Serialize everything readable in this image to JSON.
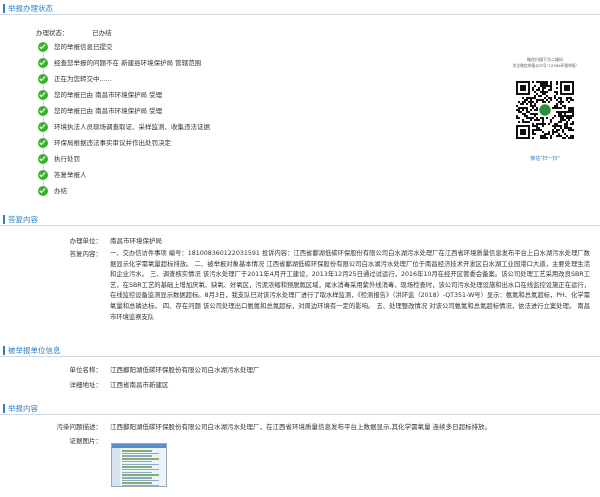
{
  "sections": {
    "progress": "举报办理状态",
    "reply": "答复内容",
    "reported_unit": "被举报单位信息",
    "report_content": "举报内容"
  },
  "status": {
    "label": "办理状态：",
    "value": "已办结"
  },
  "steps": [
    "您的举报信息已提交",
    "经查您举报的问题不在 新建县环境保护局 管辖范围",
    "正在为您转交中......",
    "您的举报已由 南昌市环境保护局 受理",
    "您的举报已由 南昌市环境保护局 受理",
    "环境执法人员现场调查取证、采样监测、收集违法证据",
    "环保局根据违法事实审议并作出处罚决定",
    "执行处罚",
    "答复举报人",
    "办结"
  ],
  "qr": {
    "caption_line1": "微信扫描下方二维码",
    "caption_line2": "关注微信举报公众号\"12369环保举报\"",
    "footer": "微信\"扫一扫\""
  },
  "reply": {
    "unit_label": "办理单位：",
    "unit_value": "南昌市环境保护局",
    "content_label": "答复内容：",
    "content_text": "一、交办信访件事项 编号：181008360122031591 投诉内容：江西省鄱湖低碳环保股份有限公司白水湖污水处理厂在江西省环境质量信息发布平台上白水湖污水处理厂数据显示化学需氧量超标排放。 二、被举报对象基本情况 江西省鄱湖低碳环保股份有限公司白水湖污水处理厂位于南昌经济技术开发区白水湖工业园港口大道，主要处理生活和企业污水。 三、调查核实情况 该污水处理厂于2011年4月开工建设，2013年12月25日通过试运行，2016年10月在经开区管委会备案。该公司处理工艺采用改良SBR工艺，在SBR工艺的基础上增加厌氧、缺氧、好氧区，污泥浓缩和预脱氮区域，尾水消毒采用紫外线消毒，现场检查时，该公司污水处理设施和出水口在线监控设施正在运行，在线监控设备监测显示数据超标。8月3日，我支队已对该污水处理厂进行了取水样监测，《检测报告》（洪环监（2018）-QT351-W号）显示：氨氮和总氮超标，PH、化学需氧量和总磷达标。 四、存在问题 该公司处理出口氨氮和总氮超标，对周边环境有一定的影响。 五、处理整改情况 对该公司氨氮和总氮超标情况，依法进行立案处理。 南昌市环境监察支队"
  },
  "reported_unit": {
    "name_label": "单位名称：",
    "name_value": "江西鄱阳湖低碳环保股份有限公司白水湖污水处理厂",
    "address_label": "详细地址：",
    "address_value": "江西省南昌市新建区"
  },
  "report_content": {
    "desc_label": "污染问题描述：",
    "desc_value": "江西鄱阳湖低碳环保股份有限公司白水湖污水处理厂，在江西省环境质量信息发布平台上数据显示,其化学需氧量 连续多日超标排放。",
    "image_label": "证据图片："
  },
  "colors": {
    "accent": "#2f7fc1",
    "done": "#3cb035"
  },
  "icons": {
    "step": "check-circle-icon",
    "qr": "qr-code-icon",
    "evidence": "screenshot-thumbnail"
  }
}
